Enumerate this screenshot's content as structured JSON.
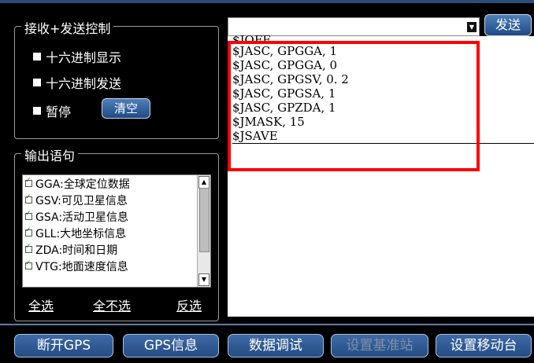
{
  "control_group": {
    "legend": "接收+发送控制",
    "hex_display": "十六进制显示",
    "hex_send": "十六进制发送",
    "pause": "暂停",
    "clear": "清空"
  },
  "send": {
    "command_value": "",
    "send_label": "发送"
  },
  "output_group": {
    "legend": "输出语句",
    "items": [
      "GGA:全球定位数据",
      "GSV:可见卫星信息",
      "GSA:活动卫星信息",
      "GLL:大地坐标信息",
      "ZDA:时间和日期",
      "VTG:地面速度信息"
    ],
    "select_all": "全选",
    "select_none": "全不选",
    "invert": "反选"
  },
  "commands": [
    "$JOFF",
    "$JASC, GPGGA, 1",
    "$JASC, GPGGA, 0",
    "$JASC, GPGSV, 0. 2",
    "$JASC, GPGSA, 1",
    "$JASC, GPZDA, 1",
    "$JMASK, 15",
    "$JSAVE"
  ],
  "bottom_buttons": [
    "断开GPS",
    "GPS信息",
    "数据调试",
    "设置基准站",
    "设置移动台"
  ],
  "colors": {
    "highlight": "#ff0000",
    "button_blue": "#2f5a95"
  }
}
